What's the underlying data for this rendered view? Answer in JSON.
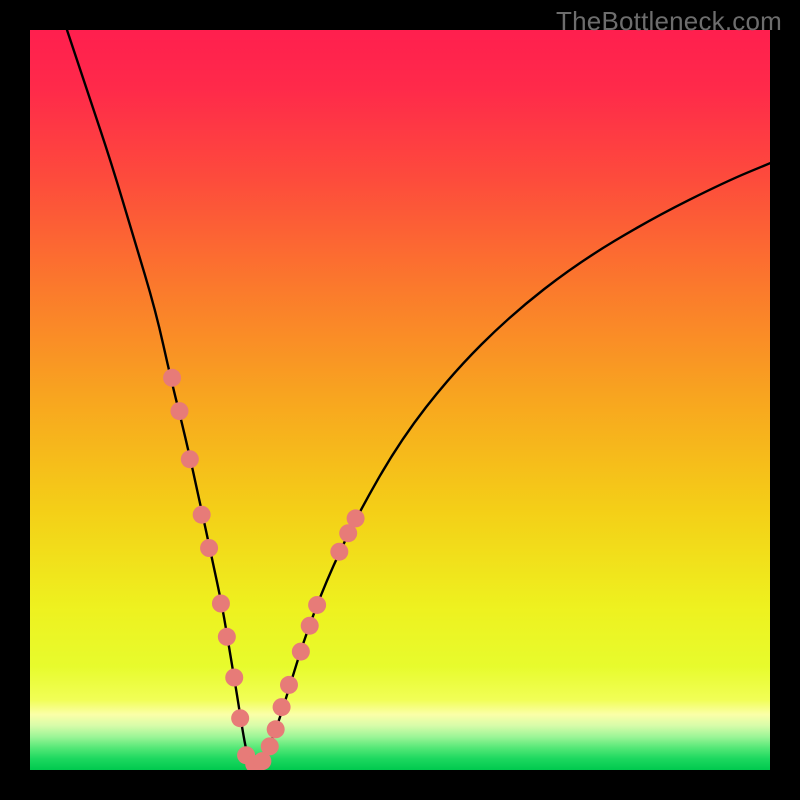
{
  "watermark": "TheBottleneck.com",
  "colors": {
    "black": "#000000",
    "curve": "#000000",
    "marker_fill": "#e77b78",
    "marker_stroke": "#c96361",
    "gradient_stops": [
      {
        "offset": 0.0,
        "color": "#ff1f4e"
      },
      {
        "offset": 0.08,
        "color": "#ff2a4a"
      },
      {
        "offset": 0.2,
        "color": "#fd4b3c"
      },
      {
        "offset": 0.35,
        "color": "#fb7a2c"
      },
      {
        "offset": 0.5,
        "color": "#f8a61f"
      },
      {
        "offset": 0.65,
        "color": "#f4cf17"
      },
      {
        "offset": 0.78,
        "color": "#eef11f"
      },
      {
        "offset": 0.86,
        "color": "#e7fb2d"
      },
      {
        "offset": 0.905,
        "color": "#f1fe56"
      },
      {
        "offset": 0.925,
        "color": "#fbffa8"
      },
      {
        "offset": 0.94,
        "color": "#d7fca9"
      },
      {
        "offset": 0.955,
        "color": "#9cf597"
      },
      {
        "offset": 0.97,
        "color": "#55e877"
      },
      {
        "offset": 0.985,
        "color": "#1cd85f"
      },
      {
        "offset": 1.0,
        "color": "#00c94e"
      }
    ]
  },
  "chart_data": {
    "type": "line",
    "title": "",
    "xlabel": "",
    "ylabel": "",
    "xlim": [
      0,
      100
    ],
    "ylim": [
      0,
      100
    ],
    "series": [
      {
        "name": "bottleneck-curve",
        "x": [
          5,
          8,
          11,
          14,
          17,
          19,
          21,
          23,
          24.5,
          26,
          27,
          28,
          28.7,
          29.3,
          30,
          31,
          32,
          33.5,
          35,
          37,
          40,
          44,
          50,
          57,
          65,
          74,
          84,
          94,
          100
        ],
        "y": [
          100,
          91,
          82,
          72,
          62,
          53,
          45,
          36,
          29,
          22,
          16,
          10,
          5.5,
          2.2,
          0.6,
          0.6,
          2.4,
          6.2,
          11,
          17.5,
          25.5,
          34,
          44.5,
          53.5,
          61.5,
          68.5,
          74.5,
          79.5,
          82
        ]
      }
    ],
    "markers": [
      {
        "x": 19.2,
        "y": 53.0
      },
      {
        "x": 20.2,
        "y": 48.5
      },
      {
        "x": 21.6,
        "y": 42.0
      },
      {
        "x": 23.2,
        "y": 34.5
      },
      {
        "x": 24.2,
        "y": 30.0
      },
      {
        "x": 25.8,
        "y": 22.5
      },
      {
        "x": 26.6,
        "y": 18.0
      },
      {
        "x": 27.6,
        "y": 12.5
      },
      {
        "x": 28.4,
        "y": 7.0
      },
      {
        "x": 29.2,
        "y": 2.0
      },
      {
        "x": 30.3,
        "y": 0.8
      },
      {
        "x": 31.4,
        "y": 1.2
      },
      {
        "x": 32.4,
        "y": 3.2
      },
      {
        "x": 33.2,
        "y": 5.5
      },
      {
        "x": 34.0,
        "y": 8.5
      },
      {
        "x": 35.0,
        "y": 11.5
      },
      {
        "x": 36.6,
        "y": 16.0
      },
      {
        "x": 37.8,
        "y": 19.5
      },
      {
        "x": 38.8,
        "y": 22.3
      },
      {
        "x": 41.8,
        "y": 29.5
      },
      {
        "x": 43.0,
        "y": 32.0
      },
      {
        "x": 44.0,
        "y": 34.0
      }
    ],
    "marker_radius_px": 9
  }
}
